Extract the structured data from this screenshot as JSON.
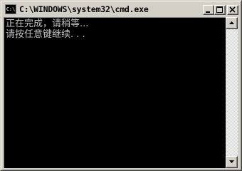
{
  "window": {
    "title": "C:\\WINDOWS\\system32\\cmd.exe",
    "icon_name": "cmd-icon",
    "icon_glyph": "C:\\"
  },
  "console": {
    "lines": [
      "正在完成，请稍等...",
      "请按任意键继续. . ."
    ],
    "text_color": "#c0c0c0",
    "background_color": "#000000"
  },
  "caption_buttons": {
    "minimize": "minimize-icon",
    "maximize": "maximize-icon",
    "close": "close-icon"
  },
  "scrollbar": {
    "up": "arrow-up-icon",
    "down": "arrow-down-icon"
  }
}
